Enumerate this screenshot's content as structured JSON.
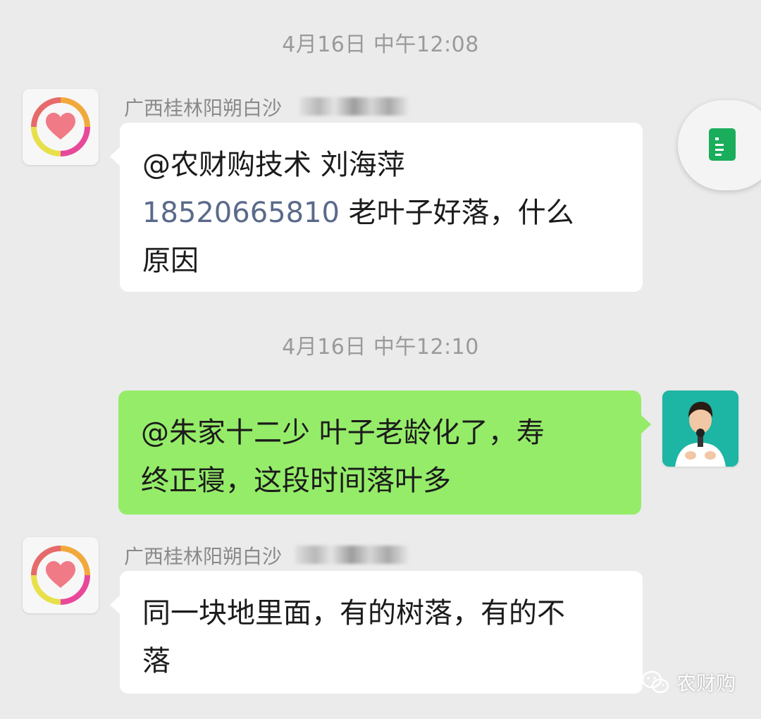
{
  "messages": [
    {
      "timestamp": "4月16日 中午12:08",
      "sender": "广西桂林阳朔白沙",
      "mention": "@农财购技术 刘海萍",
      "phone": "18520665810",
      "text_after_phone": " 老叶子好落，什么",
      "text_line3": "原因"
    },
    {
      "timestamp": "4月16日 中午12:10",
      "text_line1": "@朱家十二少  叶子老龄化了，寿",
      "text_line2": "终正寝，这段时间落叶多"
    },
    {
      "sender": "广西桂林阳朔白沙",
      "text_line1": "同一块地里面，有的树落，有的不",
      "text_line2": "落"
    }
  ],
  "watermark": {
    "icon": "wechat-icon",
    "label": "农财购"
  },
  "floating_button": {
    "icon": "document-icon",
    "color": "#1aad5c"
  },
  "colors": {
    "background": "#ebebeb",
    "incoming_bubble": "#ffffff",
    "outgoing_bubble": "#95ec69",
    "phone_link": "#5a6a8a"
  }
}
